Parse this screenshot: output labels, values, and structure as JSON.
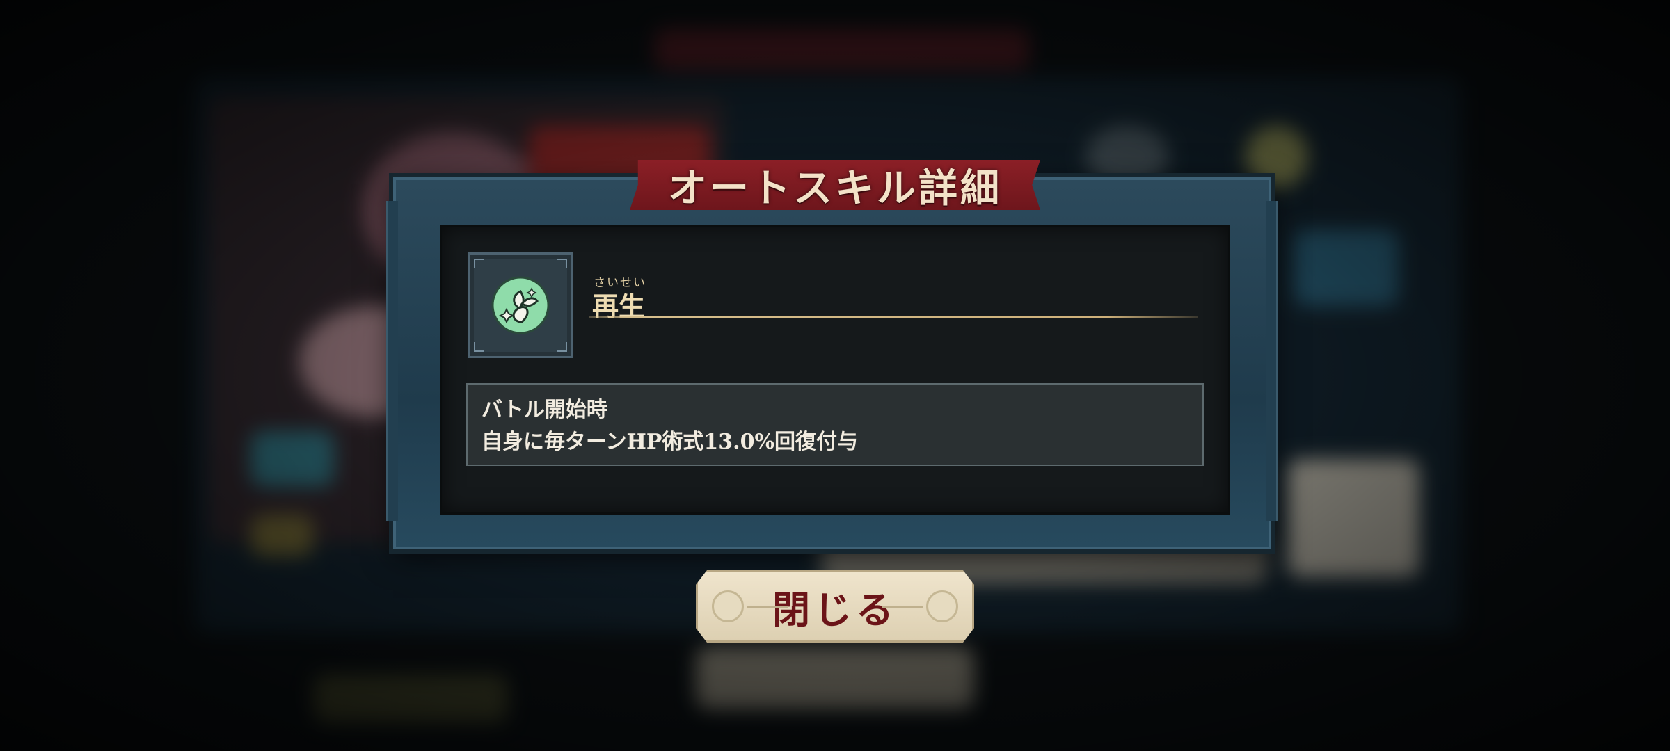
{
  "dialog": {
    "title": "オートスキル詳細"
  },
  "skill": {
    "icon": "leaf-sprout-icon",
    "icon_color": "#8fdcaa",
    "name": "再生",
    "reading": "さいせい",
    "description": [
      "バトル開始時",
      "自身に毎ターンHP術式13.0%回復付与"
    ]
  },
  "actions": {
    "close_label": "閉じる"
  },
  "colors": {
    "ribbon": "#8b1f26",
    "frame": "#2c4a5c",
    "panel": "#15191b",
    "accent_gold": "#d6be8c",
    "close_text": "#6b1418"
  }
}
